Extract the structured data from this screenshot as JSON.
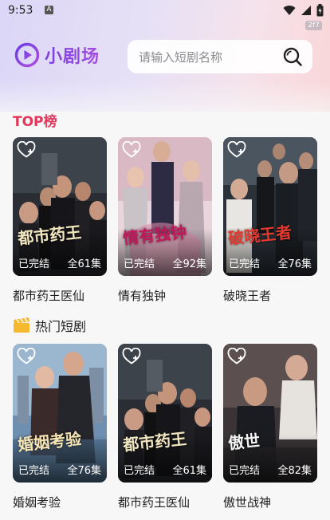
{
  "status_bar": {
    "time": "9:53",
    "notif": "A",
    "fps": "2f7"
  },
  "header": {
    "app_name": "小剧场",
    "search_placeholder": "请输入短剧名称"
  },
  "section_top": {
    "title": "TOP榜"
  },
  "section_hot": {
    "title": "热门短剧"
  },
  "top_list": [
    {
      "name": "都市药王医仙",
      "status": "已完结",
      "episodes": "全61集",
      "poster_title": "都市药王"
    },
    {
      "name": "情有独钟",
      "status": "已完结",
      "episodes": "全92集",
      "poster_title": "情有独钟"
    },
    {
      "name": "破晓王者",
      "status": "已完结",
      "episodes": "全76集",
      "poster_title": "破晓王者"
    }
  ],
  "hot_list": [
    {
      "name": "婚姻考验",
      "status": "已完结",
      "episodes": "全76集",
      "poster_title": "婚姻考验"
    },
    {
      "name": "都市药王医仙",
      "status": "已完结",
      "episodes": "全61集",
      "poster_title": "都市药王"
    },
    {
      "name": "傲世战神",
      "status": "已完结",
      "episodes": "全82集",
      "poster_title": "傲世"
    }
  ],
  "colors": {
    "accent": "#e2365b",
    "brand": "#7b3fe4"
  }
}
